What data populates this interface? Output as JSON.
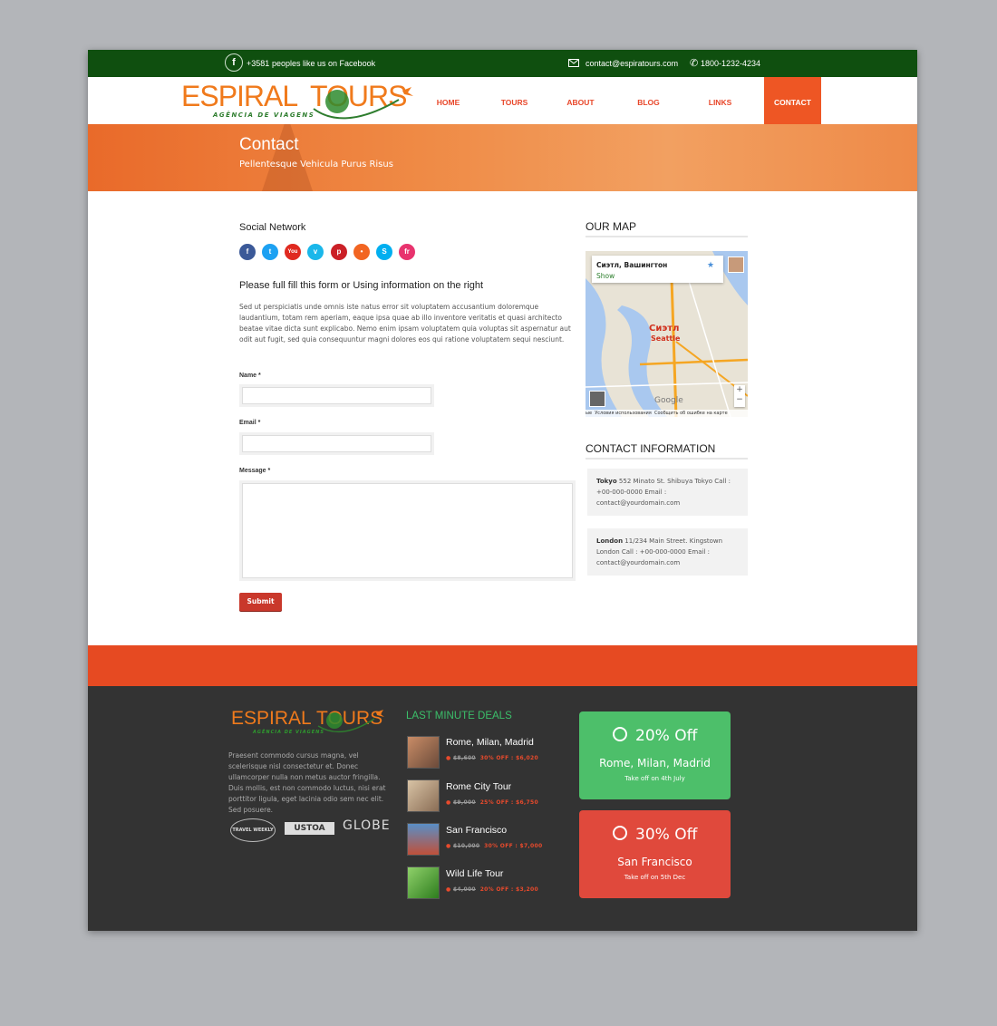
{
  "topbar": {
    "fb_count": "+3581",
    "fb_text": "peoples like us on Facebook",
    "email": "contact@espiratours.com",
    "phone": "1800-1232-4234"
  },
  "brand": {
    "name_a": "ESPIRAL",
    "name_b": "TOURS",
    "tagline": "AGÊNCIA DE VIAGENS"
  },
  "nav": [
    "HOME",
    "TOURS",
    "ABOUT",
    "BLOG",
    "LINKS",
    "CONTACT"
  ],
  "banner": {
    "title": "Contact",
    "subtitle": "Pellentesque Vehicula Purus Risus"
  },
  "social": {
    "heading": "Social Network",
    "icons": [
      "facebook-icon",
      "twitter-icon",
      "youtube-icon",
      "vimeo-icon",
      "pinterest-icon",
      "rss-icon",
      "skype-icon",
      "friendfeed-icon"
    ]
  },
  "form": {
    "heading": "Please full fill this form or Using information on the right",
    "intro": "Sed ut perspiciatis unde omnis iste natus error sit voluptatem accusantium doloremque laudantium, totam rem aperiam, eaque ipsa quae ab illo inventore veritatis et quasi architecto beatae vitae dicta sunt explicabo. Nemo enim ipsam voluptatem quia voluptas sit aspernatur aut odit aut fugit, sed quia consequuntur magni dolores eos qui ratione voluptatem sequi nesciunt.",
    "name_label": "Name *",
    "email_label": "Email *",
    "message_label": "Message *",
    "submit": "Submit"
  },
  "map": {
    "heading": "OUR MAP",
    "place": "Сиэтл, Вашингтон",
    "show": "Show",
    "city_ru": "Сиэтл",
    "city_en": "Seattle",
    "google": "Google",
    "footer_a": "Условия использования",
    "footer_b": "Сообщить об ошибке на карте",
    "footer_c": "ые"
  },
  "contact": {
    "heading": "CONTACT INFORMATION",
    "tokyo_city": "Tokyo",
    "tokyo_text": "552 Minato St. Shibuya Tokyo Call : +00-000-0000 Email : contact@yourdomain.com",
    "london_city": "London",
    "london_text": "11/234 Main Street. Kingstown London Call : +00-000-0000 Email : contact@yourdomain.com"
  },
  "footer": {
    "about": "Praesent commodo cursus magna, vel scelerisque nisl consectetur et. Donec ullamcorper nulla non metus auctor fringilla. Duis mollis, est non commodo luctus, nisi erat porttitor ligula, eget lacinia odio sem nec elit. Sed posuere.",
    "partners": [
      "TRAVEL WEEKLY",
      "USTOA",
      "GLOBE"
    ],
    "deals_heading": "LAST MINUTE DEALS",
    "deals": [
      {
        "title": "Rome, Milan, Madrid",
        "old": "$8,600",
        "offer": "30% OFF : $6,020"
      },
      {
        "title": "Rome City Tour",
        "old": "$9,000",
        "offer": "25% OFF : $6,750"
      },
      {
        "title": "San Francisco",
        "old": "$10,000",
        "offer": "30% OFF : $7,000"
      },
      {
        "title": "Wild Life Tour",
        "old": "$4,000",
        "offer": "20% OFF : $3,200"
      }
    ],
    "promos": [
      {
        "off": "20% Off",
        "place": "Rome, Milan, Madrid",
        "note": "Take off on 4th July",
        "color": "#4dbf6a"
      },
      {
        "off": "30% Off",
        "place": "San Francisco",
        "note": "Take off on 5th Dec",
        "color": "#e0493c"
      }
    ]
  },
  "colors": {
    "green": "#0f4f0f",
    "orange": "#e64a22",
    "accent": "#ee5624",
    "dark": "#333333"
  }
}
